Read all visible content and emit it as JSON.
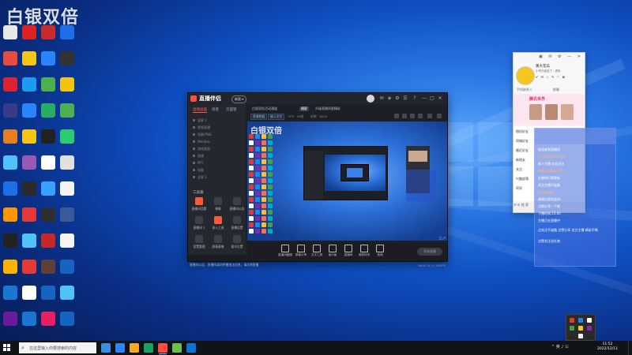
{
  "watermark": "白银双倍",
  "desktop": {
    "icon_colors": [
      "#e8e8e8",
      "#d22",
      "#c92a2a",
      "#1e6ee8",
      "#e74c3c",
      "#f5c518",
      "#2b84ff",
      "#333",
      "#d23",
      "#1d9bf0",
      "#4caf50",
      "#f1c40f",
      "#3a3a8a",
      "#2b84ff",
      "#27ae60",
      "#4caf50",
      "#e67e22",
      "#f5c518",
      "#222",
      "#2ecc71",
      "#4fc3f7",
      "#9b59b6",
      "#fff",
      "#e0e0e0",
      "#1e6ee8",
      "#2b2b2b",
      "#3aa0ff",
      "#f5f5f5",
      "#ff9800",
      "#e53935",
      "#2f2f2f",
      "#3a5a9a",
      "#222",
      "#4fc3f7",
      "#c62828",
      "#f5f5f5",
      "#ffb300",
      "#e53935",
      "#5d4037",
      "#1565c0",
      "#1976d2",
      "#ffffff",
      "#1565c0",
      "#4fc3f7",
      "#6a1b9a",
      "#1976d2",
      "#e91e63",
      "#1565c0",
      "#2a9df4",
      "#fff",
      "#1e88e5",
      "#d32f2f",
      "#1e88e5",
      "#f5f5f5",
      "#388e3c",
      "#455a64",
      "#263238",
      "#1565c0",
      "#c62828",
      "#eceff1",
      "#ff7043",
      "#ffb300",
      "#4e342e",
      "#6d4c41",
      "#8e24aa",
      "#e53935",
      "#ff8f00",
      "#1e88e5",
      "#3949ab",
      "#1565c0",
      "#263238",
      "#1565c0",
      "#f5f5f5",
      "#1e88e5",
      "#5d4037",
      "#e53935"
    ]
  },
  "app": {
    "name": "直播伴侣",
    "version_badge": "新版 ▾",
    "sidebar_tabs": [
      "直播画面",
      "场景",
      "页面管"
    ],
    "scenes": [
      "竖屏 1",
      "视频直播",
      "场景/PNG",
      "Window",
      "游戏画面",
      "直播",
      "PPT",
      "电脑",
      "全屏 1"
    ],
    "tools_header": "工具箱",
    "tools": [
      {
        "label": "直播间话题",
        "color": "#ff5a3c"
      },
      {
        "label": "弹幕",
        "color": "#3b3f4a"
      },
      {
        "label": "直播间公告",
        "color": "#3b3f4a"
      },
      {
        "label": "直播间 2",
        "color": "#3b3f4a"
      },
      {
        "label": "录入工具",
        "color": "#ff5a3c"
      },
      {
        "label": "直播设置",
        "color": "#3b3f4a"
      },
      {
        "label": "设置管理",
        "color": "#3b3f4a"
      },
      {
        "label": "屏幕录像",
        "color": "#3b3f4a"
      },
      {
        "label": "观众位置",
        "color": "#3b3f4a"
      }
    ],
    "main_tabs": [
      "白银双倍活动通道",
      "横屏",
      "升级直播间更精彩"
    ],
    "info_chips": [
      "直播数据",
      "输入文字"
    ],
    "info_items": [
      "FPS：30帧",
      "码率：6004"
    ],
    "preview_watermark": "白银双倍",
    "preview_ctrl": "□ ⤢",
    "bottom_tools": [
      "直播间截图",
      "屏幕分享",
      "文字工具",
      "画中画",
      "直播间",
      "美颜特效",
      "音频"
    ],
    "live_button": "开始直播",
    "status_left": "直播间公告：直播间请勿传播违法信息，请文明直播",
    "status_right": "Build 11.0  |  60FPS"
  },
  "chat": {
    "name": "黄大花瓜",
    "signature": "小号已经没了…资料",
    "icons_row": "✔ ✉ ☆ ✎ ♡ ✿",
    "tabs": [
      "手机联系人",
      "群聊"
    ],
    "ad_title": "腾讯世界",
    "rows": [
      "相机好友",
      "同城好友",
      "最近好友",
      "新朋友",
      "关注",
      "兴趣部落",
      "同学"
    ],
    "footer": "☰ ⚙  搜 索",
    "title_buttons": "▣ ✉ ⚙ — ✕"
  },
  "overlay": {
    "lines": [
      "欢迎来到直播间",
      "白银双倍活动开启中",
      "新人主播 欢迎关注",
      "直播间福利抽奖中",
      "礼物排行榜更新",
      "关注主播不迷路",
      "欢迎新朋友",
      "感谢大家的支持",
      "点赞分享一下吧",
      "下播时间 23:00",
      "主播正在直播中"
    ],
    "orange_lines": [
      1,
      3,
      6
    ],
    "footer": "点关注不迷路 点赞分享 关注主播 精彩不断",
    "footer2": "点赞关注送礼物"
  },
  "taskbar": {
    "search_placeholder": "在这里输入你要搜索的内容",
    "apps": [
      "#3a8ee6",
      "#2b84ff",
      "#f5a623",
      "#1aa260",
      "#ff4d3d",
      "#6cc04a",
      "#0a74da"
    ],
    "tray_text": "^ 英 ♪ ☷",
    "time": "11:52",
    "date": "2022/12/11"
  }
}
